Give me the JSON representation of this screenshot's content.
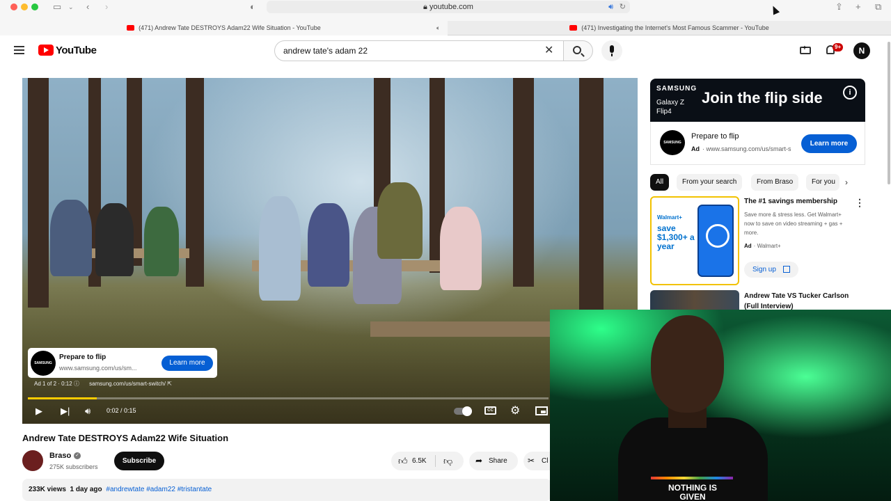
{
  "browser": {
    "url": "youtube.com",
    "tabs": [
      {
        "label": "(471) Andrew Tate DESTROYS Adam22 Wife Situation - YouTube",
        "active": true
      },
      {
        "label": "(471) Investigating the Internet's Most Famous Scammer - YouTube",
        "active": false
      }
    ]
  },
  "masthead": {
    "logo_text": "YouTube",
    "search_value": "andrew tate's adam 22",
    "notification_count": "9+",
    "avatar_letter": "N"
  },
  "player": {
    "ad_card": {
      "title": "Prepare to flip",
      "url": "www.samsung.com/us/sm...",
      "cta": "Learn more",
      "logo": "SAMSUNG"
    },
    "ad_status": "Ad 1 of 2 · 0:12",
    "ad_url": "samsung.com/us/smart-switch/",
    "time": "0:02 / 0:15",
    "progress": 0.133,
    "colors": {
      "progress_fill": "#ffcc00"
    }
  },
  "video": {
    "title": "Andrew Tate DESTROYS Adam22 Wife Situation",
    "channel": "Braso",
    "subscribers": "275K subscribers",
    "subscribe_label": "Subscribe",
    "likes": "6.5K",
    "share_label": "Share",
    "clip_label": "Cl",
    "views": "233K views",
    "age": "1 day ago",
    "hashtags": "#andrewtate #adam22 #tristantate"
  },
  "sidebar": {
    "banner": {
      "brand": "SAMSUNG",
      "model": "Galaxy Z Flip4",
      "headline": "Join the flip side"
    },
    "ad": {
      "title": "Prepare to flip",
      "ad_label": "Ad",
      "url": "www.samsung.com/us/smart-s",
      "cta": "Learn more",
      "logo": "SAMSUNG"
    },
    "chips": [
      "All",
      "From your search",
      "From Braso",
      "For you"
    ],
    "walmart": {
      "thumb_brand": "Walmart+",
      "thumb_save": "save $1,300+ a year",
      "title": "The #1 savings membership",
      "description": "Save more & stress less. Get Walmart+ now to save on video streaming + gas + more.",
      "ad_label": "Ad",
      "advertiser": "Walmart+",
      "cta": "Sign up"
    },
    "recommendation": {
      "title": "Andrew Tate VS Tucker Carlson (Full Interview)"
    }
  },
  "webcam": {
    "shirt_text": "NOTHING IS GIVEN"
  }
}
